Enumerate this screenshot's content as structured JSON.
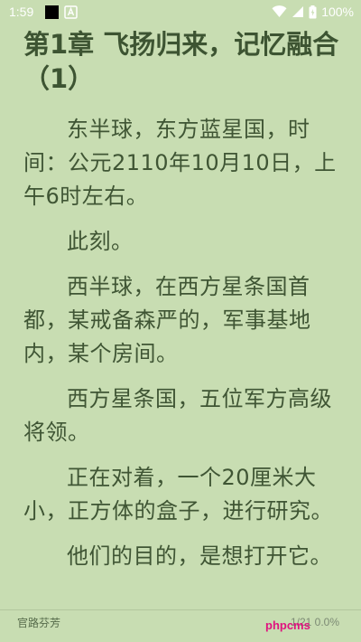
{
  "status_bar": {
    "time": "1:59",
    "battery_percent": "100%",
    "icons": [
      "black-square-icon",
      "a-notification-icon",
      "wifi-icon",
      "signal-icon",
      "battery-icon"
    ]
  },
  "chapter": {
    "title": "第1章 飞扬归来，记忆融合（1）",
    "paragraphs": [
      "东半球，东方蓝星国，时间：公元2110年10月10日，上午6时左右。",
      "此刻。",
      "西半球，在西方星条国首都，某戒备森严的，军事基地内，某个房间。",
      "西方星条国，五位军方高级将领。",
      "正在对着，一个20厘米大小，正方体的盒子，进行研究。",
      "他们的目的，是想打开它。"
    ]
  },
  "footer": {
    "book_name": "官路芬芳",
    "progress": "1/21  0.0%",
    "watermark": "phpcms"
  },
  "colors": {
    "background": "#c8ddb2",
    "text": "#3f5534",
    "watermark": "#e0127f"
  }
}
